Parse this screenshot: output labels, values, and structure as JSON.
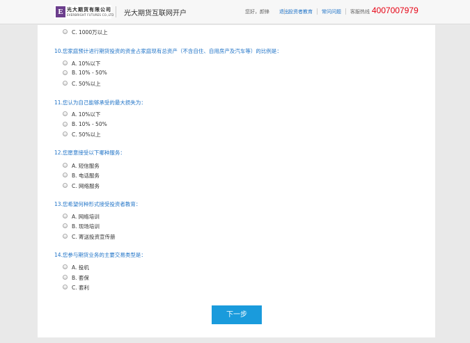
{
  "header": {
    "logo_mark": "E",
    "logo_cn": "光大期货有限公司",
    "logo_en": "EVERBRIGHT FUTURES CO.,LTD",
    "site_title": "光大期货互联网开户",
    "greeting": "您好，颜锋",
    "logout": "退出",
    "investor_education": "投资者教育",
    "faq": "常问问题",
    "hotline_label": "客服热线",
    "hotline_number": "4007007979"
  },
  "questions": [
    {
      "title": "",
      "options": [
        "C. 1000万以上"
      ]
    },
    {
      "title": "10.您家庭预计进行期货投资的资金占家庭现有总资产（不含自住、自用房产及汽车等）的比例是：",
      "options": [
        "A. 10%以下",
        "B. 10% - 50%",
        "C. 50%以上"
      ]
    },
    {
      "title": "11.您认为自己能够承受的最大损失为：",
      "options": [
        "A. 10%以下",
        "B. 10% - 50%",
        "C. 50%以上"
      ]
    },
    {
      "title": "12.您愿意接受以下哪种服务：",
      "options": [
        "A. 短信服务",
        "B. 电话服务",
        "C. 网络服务"
      ]
    },
    {
      "title": "13.您希望何种形式接受投资者教育：",
      "options": [
        "A. 网络培训",
        "B. 现场培训",
        "C. 寄送投资宣传册"
      ]
    },
    {
      "title": "14.您参与期货业务的主要交易类型是：",
      "options": [
        "A. 投机",
        "B. 套保",
        "C. 套利"
      ]
    }
  ],
  "next_button": "下一步"
}
